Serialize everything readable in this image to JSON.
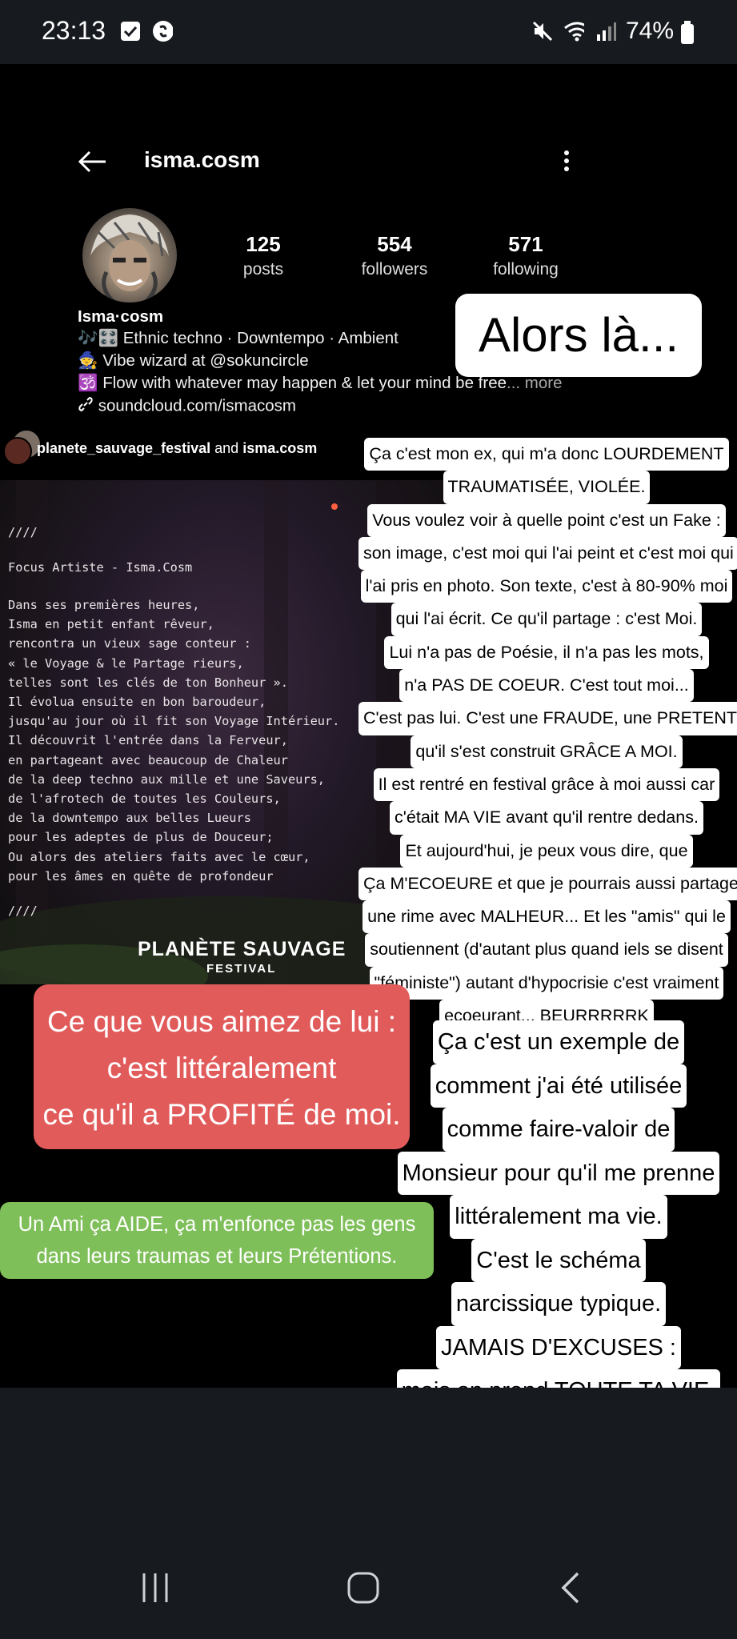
{
  "status_bar": {
    "time": "23:13",
    "battery": "74%",
    "icons": [
      "check-icon",
      "shazam-icon",
      "mute-icon",
      "wifi-icon",
      "signal-icon",
      "battery-icon"
    ]
  },
  "profile": {
    "handle": "isma.cosm",
    "stats": [
      {
        "value": "125",
        "label": "posts"
      },
      {
        "value": "554",
        "label": "followers"
      },
      {
        "value": "571",
        "label": "following"
      }
    ],
    "name": "Isma·cosm",
    "bio": [
      "🎶🎛️ Ethnic techno · Downtempo · Ambient",
      "🧙 Vibe wizard at @sokuncircle",
      "🕉️ Flow with whatever may happen & let your mind be free"
    ],
    "bio_more": "... more",
    "link": "soundcloud.com/ismacosm"
  },
  "post": {
    "account_primary": "planete_sauvage_festival",
    "account_joiner": "and",
    "account_secondary": "isma.cosm",
    "poem_top": "////",
    "poem_title": "Focus Artiste - Isma.Cosm",
    "poem_body": [
      "Dans ses premières heures,",
      "Isma en petit enfant rêveur,",
      "rencontra un vieux sage conteur :",
      "« le Voyage & le Partage rieurs,",
      "telles sont les clés de ton Bonheur ».",
      "Il évolua ensuite en bon baroudeur,",
      "jusqu'au jour où il fit son Voyage Intérieur.",
      "Il découvrit l'entrée dans la Ferveur,",
      "en partageant avec beaucoup de Chaleur",
      "de la deep techno aux mille et une Saveurs,",
      "de l'afrotech de toutes les Couleurs,",
      "de la downtempo aux belles Lueurs",
      "pour les adeptes de plus de Douceur;",
      "Ou alors des ateliers faits avec le cœur,",
      "pour les âmes en quête de profondeur"
    ],
    "poem_bottom": "////",
    "festival_name": "PLANÈTE SAUVAGE",
    "festival_sub": "FESTIVAL"
  },
  "stickers": {
    "alors": "Alors là...",
    "right_block": [
      "Ça c'est mon ex, qui m'a donc LOURDEMENT",
      "TRAUMATISÉE, VIOLÉE.",
      "Vous voulez voir à quelle point c'est un Fake :",
      "son image, c'est moi qui l'ai peint et c'est moi qui",
      "l'ai pris en photo. Son texte, c'est à 80-90% moi",
      "qui l'ai écrit. Ce qu'il partage : c'est Moi.",
      "Lui n'a pas de Poésie, il n'a pas les mots,",
      "n'a PAS DE COEUR. C'est tout moi...",
      "C'est pas lui. C'est une FRAUDE, une PRETENTION",
      "qu'il s'est construit GRÂCE A MOI.",
      "Il est rentré en festival grâce à moi aussi car",
      "c'était MA VIE avant qu'il rentre dedans.",
      "Et aujourd'hui, je peux vous dire, que",
      "Ça M'ECOEURE et que je pourrais aussi partager",
      "une rime avec MALHEUR... Et les \"amis\" qui le",
      "soutiennent (d'autant plus quand iels se disent",
      "\"féministe\") autant d'hypocrisie c'est vraiment",
      "ecoeurant... BEURRRRRK",
      "🤮🤮🤮🤮🤮🤮🤮"
    ],
    "red": [
      "Ce que vous aimez de lui :",
      "c'est littéralement",
      "ce qu'il a PROFITÉ de moi."
    ],
    "green": [
      "Un Ami ça AIDE, ça m'enfonce pas les gens",
      "dans leurs traumas et leurs Prétentions."
    ],
    "bottom_right": [
      "Ça c'est un exemple de",
      "comment j'ai été utilisée",
      "comme faire-valoir de",
      "Monsieur pour qu'il me prenne",
      "littéralement ma vie.",
      "C'est le schéma",
      "narcissique typique.",
      "JAMAIS D'EXCUSES :",
      "mais on prend TOUTE TA VIE."
    ]
  },
  "colors": {
    "status_bg": "#171a1f",
    "red_sticker": "#e25b5b",
    "green_sticker": "#7fbf5a"
  }
}
